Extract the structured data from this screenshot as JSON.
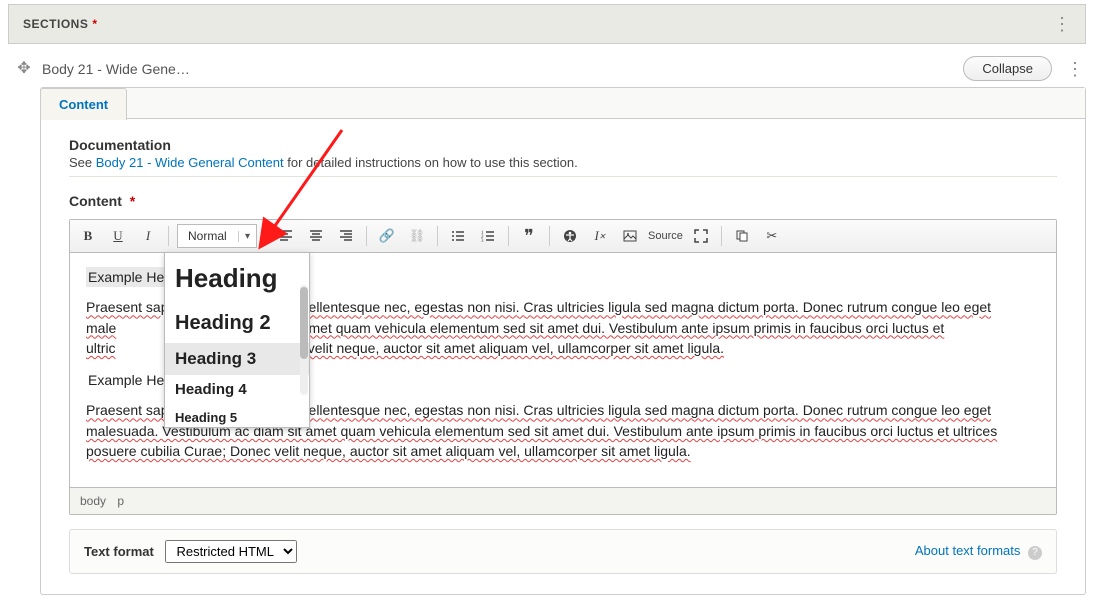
{
  "sections_label": "SECTIONS",
  "body_title": "Body 21 - Wide Gene…",
  "collapse_label": "Collapse",
  "tab_label": "Content",
  "doc_heading": "Documentation",
  "doc_prefix": "See ",
  "doc_link": "Body 21 - Wide General Content",
  "doc_suffix": " for detailed instructions on how to use this section.",
  "content_label": "Content",
  "format_dd_value": "Normal",
  "dd_items": {
    "h1": "Heading",
    "h2": "Heading 2",
    "h3": "Heading 3",
    "h4": "Heading 4",
    "h5": "Heading 5"
  },
  "toolbar": {
    "bold": "B",
    "underline": "U",
    "italic": "I",
    "source": "Source"
  },
  "editor": {
    "ex_head_1": "Example Hea",
    "para_1a": "Praesent sap",
    "para_1b": "pellentesque nec, egestas non nisi. Cras ultricies ligula sed magna dictum porta. Donec rutrum congue leo eget male",
    "para_1c": "diam sit amet quam vehicula elementum sed sit amet dui. Vestibulum ante ipsum primis in faucibus orci luctus et ultric",
    "para_1d": "e; Donec velit neque, auctor sit amet aliquam vel, ullamcorper sit amet ligula.",
    "ex_head_2": "Example Hea",
    "para_2": "Praesent sap",
    "para_2b": "pellentesque nec, egestas non nisi. Cras ultricies ligula sed magna dictum porta. Donec rutrum congue leo eget malesuada. Vestibulum ac diam sit amet quam vehicula elementum sed sit amet dui. Vestibulum ante ipsum primis in faucibus orci luctus et ultrices posuere cubilia Curae; Donec velit neque, auctor sit amet aliquam vel, ullamcorper sit amet ligula."
  },
  "path": {
    "body": "body",
    "p": "p"
  },
  "text_format_label": "Text format",
  "text_format_value": "Restricted HTML",
  "about_link": "About text formats"
}
